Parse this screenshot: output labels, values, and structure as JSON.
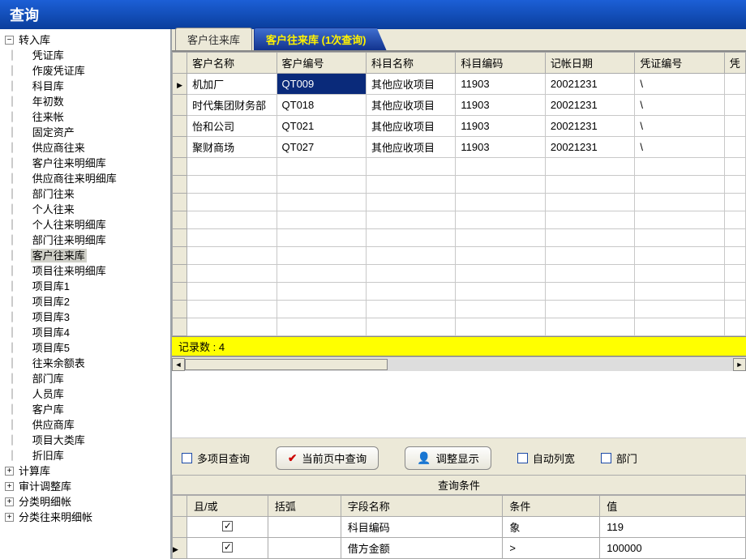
{
  "window": {
    "title": "查询"
  },
  "tree": {
    "root": {
      "label": "转入库",
      "expanded": true
    },
    "children": [
      "凭证库",
      "作废凭证库",
      "科目库",
      "年初数",
      "往来帐",
      "固定资产",
      "供应商往来",
      "客户往来明细库",
      "供应商往来明细库",
      "部门往来",
      "个人往来",
      "个人往来明细库",
      "部门往来明细库",
      "客户往来库",
      "项目往来明细库",
      "项目库1",
      "项目库2",
      "项目库3",
      "项目库4",
      "项目库5",
      "往来余额表",
      "部门库",
      "人员库",
      "客户库",
      "供应商库",
      "项目大类库",
      "折旧库"
    ],
    "selectedIndex": 13,
    "siblings": [
      {
        "label": "计算库",
        "expanded": false
      },
      {
        "label": "审计调整库",
        "expanded": false
      },
      {
        "label": "分类明细帐",
        "expanded": false
      },
      {
        "label": "分类往来明细帐",
        "expanded": false
      }
    ]
  },
  "tabs": {
    "items": [
      {
        "label": "客户往来库",
        "active": false
      },
      {
        "label": "客户往来库 (1次查询)",
        "active": true
      }
    ]
  },
  "grid": {
    "columns": [
      "客户名称",
      "客户编号",
      "科目名称",
      "科目编码",
      "记帐日期",
      "凭证编号",
      "凭"
    ],
    "rows": [
      {
        "pointer": true,
        "cells": [
          "机加厂",
          "QT009",
          "其他应收项目",
          "11903",
          "20021231",
          "\\"
        ],
        "selCol": 1
      },
      {
        "pointer": false,
        "cells": [
          "时代集团财务部",
          "QT018",
          "其他应收项目",
          "11903",
          "20021231",
          "\\"
        ],
        "selCol": -1
      },
      {
        "pointer": false,
        "cells": [
          "怡和公司",
          "QT021",
          "其他应收项目",
          "11903",
          "20021231",
          "\\"
        ],
        "selCol": -1
      },
      {
        "pointer": false,
        "cells": [
          "聚财商场",
          "QT027",
          "其他应收项目",
          "11903",
          "20021231",
          "\\"
        ],
        "selCol": -1
      }
    ],
    "blankRows": 10,
    "recordStatus": "记录数 : 4"
  },
  "toolbar": {
    "multiQuery": "多项目查询",
    "searchInPage": "当前页中查询",
    "adjustDisplay": "调整显示",
    "autoWidth": "自动列宽",
    "dept": "部门"
  },
  "conditions": {
    "title": "查询条件",
    "columns": [
      "且/或",
      "括弧",
      "字段名称",
      "条件",
      "值"
    ],
    "rows": [
      {
        "pointer": false,
        "andOr": true,
        "bracket": "",
        "field": "科目编码",
        "op": "象",
        "value": "119"
      },
      {
        "pointer": true,
        "andOr": true,
        "bracket": "",
        "field": "借方金额",
        "op": ">",
        "value": "100000"
      }
    ]
  }
}
